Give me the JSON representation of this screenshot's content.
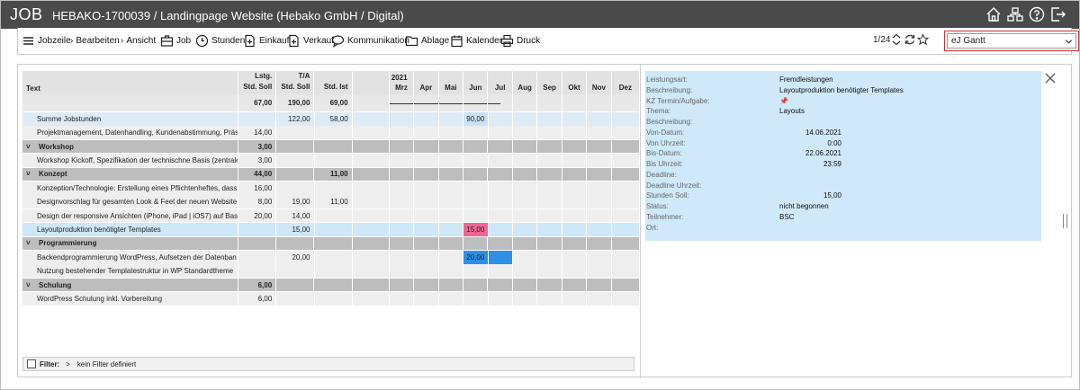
{
  "titlebar": {
    "app": "JOB",
    "title": "HEBAKO-1700039 / Landingpage Website (Hebako GmbH / Digital)"
  },
  "toolbar": {
    "jobzeile": "Jobzeile",
    "bearbeiten": "Bearbeiten",
    "ansicht": "Ansicht",
    "job": "Job",
    "stunden": "Stunden",
    "einkauf": "Einkauf",
    "verkauf": "Verkauf",
    "kommunikation": "Kommunikation",
    "ablage": "Ablage",
    "kalender": "Kalender",
    "druck": "Druck",
    "pager": "1/24",
    "view": "eJ Gantt"
  },
  "table": {
    "headers": {
      "text": "Text",
      "lstg1": "Lstg.",
      "lstg2": "Std. Soll",
      "ta1": "T/A",
      "ta2": "Std. Soll",
      "ist2": "Std. Ist",
      "year": "2021"
    },
    "months": [
      "Mrz",
      "Apr",
      "Mai",
      "Jun",
      "Jul",
      "Aug",
      "Sep",
      "Okt",
      "Nov",
      "Dez"
    ],
    "totals": {
      "lstg": "67,00",
      "ta": "190,00",
      "ist": "69,00"
    },
    "rows": [
      {
        "kind": "r1",
        "text": "Summe Jobstunden",
        "lstg": "",
        "ta": "122,00",
        "ist": "58,00",
        "bar": {
          "col": 3,
          "val": "90,00",
          "style": "bar-lb"
        }
      },
      {
        "kind": "r0",
        "text": "Projektmanagement, Datenhandling, Kundenabstimmung, Präs",
        "lstg": "14,00",
        "ta": "",
        "ist": ""
      },
      {
        "kind": "group",
        "toggle": "˅",
        "text": "Workshop",
        "lstg": "3,00",
        "ta": "",
        "ist": ""
      },
      {
        "kind": "r0",
        "text": "Workshop Kickoff, Spezifikation der technischne Basis (zentrale",
        "lstg": "3,00",
        "ta": "",
        "ist": ""
      },
      {
        "kind": "group",
        "toggle": "˅",
        "text": "Konzept",
        "lstg": "44,00",
        "ta": "",
        "ist": "11,00"
      },
      {
        "kind": "r0",
        "text": "Konzeption/Technologie: Erstellung eines Pflichtenheftes, dass",
        "lstg": "16,00",
        "ta": "",
        "ist": ""
      },
      {
        "kind": "r0",
        "text": "Designvorschlag für gesamten Look & Feel der neuen Website.",
        "lstg": "8,00",
        "ta": "19,00",
        "ist": "11,00"
      },
      {
        "kind": "r0",
        "text": "Design der responsive Ansichten (iPhone, iPad | iOS7) auf Basis",
        "lstg": "20,00",
        "ta": "14,00",
        "ist": ""
      },
      {
        "kind": "hl",
        "text": "Layoutproduktion benötigter Templates",
        "lstg": "",
        "ta": "15,00",
        "ist": "",
        "bar": {
          "col": 3,
          "val": "15,00",
          "style": "bar-pink"
        }
      },
      {
        "kind": "group",
        "toggle": "˅",
        "text": "Programmierung",
        "lstg": "",
        "ta": "",
        "ist": ""
      },
      {
        "kind": "r0",
        "text": "Backendprogrammierung WordPress, Aufsetzen der Datenban",
        "lstg": "",
        "ta": "20,00",
        "ist": "",
        "bar": {
          "col": 3,
          "val": "20,00",
          "style": "bar-blue",
          "col2": 4
        }
      },
      {
        "kind": "r0",
        "text": "Nutzung bestehender Templatestruktur in WP Standardtheme",
        "lstg": "",
        "ta": "",
        "ist": ""
      },
      {
        "kind": "group",
        "toggle": "˅",
        "text": "Schulung",
        "lstg": "6,00",
        "ta": "",
        "ist": ""
      },
      {
        "kind": "r0",
        "text": "WordPress Schulung inkl. Vorbereitung",
        "lstg": "6,00",
        "ta": "",
        "ist": ""
      }
    ]
  },
  "filter": {
    "label": "Filter:",
    "arrow": ">",
    "value": "kein Filter definiert"
  },
  "details": [
    {
      "k": "Leistungsart:",
      "v": "Fremdleistungen",
      "align": "l"
    },
    {
      "k": "Beschreibung:",
      "v": "Layoutproduktion benötigter Templates",
      "align": "l"
    },
    {
      "k": "KZ Termin/Aufgabe:",
      "v": "📌",
      "align": "l"
    },
    {
      "k": "Thema:",
      "v": "Layouts",
      "align": "l"
    },
    {
      "k": "Beschreibung:",
      "v": "",
      "align": "l"
    },
    {
      "k": "Von-Datum:",
      "v": "14.06.2021",
      "align": "r"
    },
    {
      "k": "Von Uhrzeit:",
      "v": "0:00",
      "align": "r"
    },
    {
      "k": "Bis-Datum:",
      "v": "22.06.2021",
      "align": "r"
    },
    {
      "k": "Bis Uhrzeit:",
      "v": "23:59",
      "align": "r"
    },
    {
      "k": "Deadline:",
      "v": "",
      "align": "l"
    },
    {
      "k": "Deadline Uhrzeit:",
      "v": "",
      "align": "l"
    },
    {
      "k": "Stunden Soll:",
      "v": "15,00",
      "align": "r"
    },
    {
      "k": "Status:",
      "v": "nicht begonnen",
      "align": "l"
    },
    {
      "k": "Teilnehmer:",
      "v": "BSC",
      "align": "l"
    },
    {
      "k": "Ort:",
      "v": "",
      "align": "l"
    }
  ]
}
